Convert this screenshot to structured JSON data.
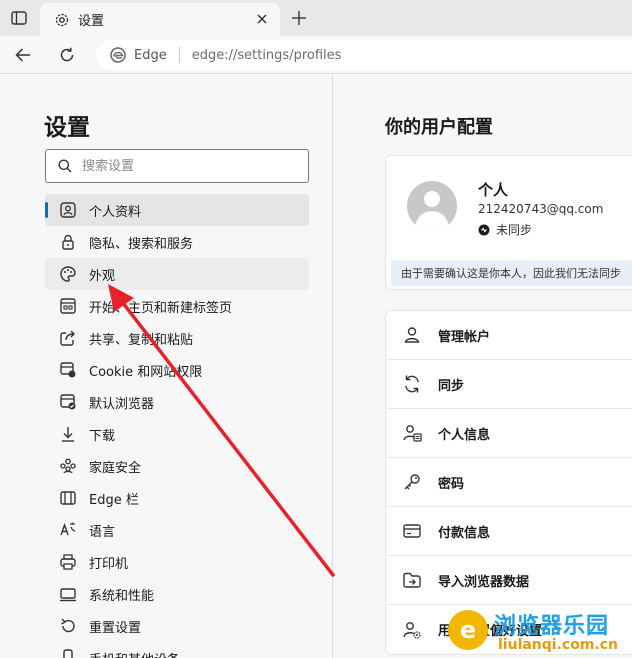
{
  "tab": {
    "title": "设置"
  },
  "address": {
    "brand": "Edge",
    "url_scheme": "edge://",
    "url_rest": "settings/profiles"
  },
  "sidebar": {
    "heading": "设置",
    "search_placeholder": "搜索设置",
    "items": [
      {
        "label": "个人资料",
        "icon": "profile-icon",
        "state": "active"
      },
      {
        "label": "隐私、搜索和服务",
        "icon": "lock-icon",
        "state": ""
      },
      {
        "label": "外观",
        "icon": "palette-icon",
        "state": "hover"
      },
      {
        "label": "开始、主页和新建标签页",
        "icon": "start-page-icon",
        "state": ""
      },
      {
        "label": "共享、复制和粘贴",
        "icon": "share-icon",
        "state": ""
      },
      {
        "label": "Cookie 和网站权限",
        "icon": "site-permissions-icon",
        "state": ""
      },
      {
        "label": "默认浏览器",
        "icon": "default-browser-icon",
        "state": ""
      },
      {
        "label": "下载",
        "icon": "download-icon",
        "state": ""
      },
      {
        "label": "家庭安全",
        "icon": "family-icon",
        "state": ""
      },
      {
        "label": "Edge 栏",
        "icon": "edge-bar-icon",
        "state": ""
      },
      {
        "label": "语言",
        "icon": "language-icon",
        "state": ""
      },
      {
        "label": "打印机",
        "icon": "printer-icon",
        "state": ""
      },
      {
        "label": "系统和性能",
        "icon": "system-icon",
        "state": ""
      },
      {
        "label": "重置设置",
        "icon": "reset-icon",
        "state": ""
      },
      {
        "label": "手机和其他设备",
        "icon": "phone-icon",
        "state": ""
      }
    ]
  },
  "content": {
    "heading": "你的用户配置",
    "profile": {
      "name": "个人",
      "email": "212420743@qq.com",
      "sync_status": "未同步"
    },
    "notice": "由于需要确认这是你本人，因此我们无法同步",
    "options": [
      {
        "label": "管理帐户",
        "icon": "account-icon"
      },
      {
        "label": "同步",
        "icon": "sync-icon"
      },
      {
        "label": "个人信息",
        "icon": "personal-info-icon"
      },
      {
        "label": "密码",
        "icon": "key-icon"
      },
      {
        "label": "付款信息",
        "icon": "payment-card-icon"
      },
      {
        "label": "导入浏览器数据",
        "icon": "import-icon"
      },
      {
        "label": "用户配置偏好设置",
        "icon": "profile-preferences-icon"
      }
    ]
  },
  "annotation": {
    "color": "#e8212b",
    "points_to": "外观"
  },
  "watermark": {
    "title": "浏览器乐园",
    "subtitle": "liulanqi.com.cn",
    "logo_letter": "e"
  }
}
